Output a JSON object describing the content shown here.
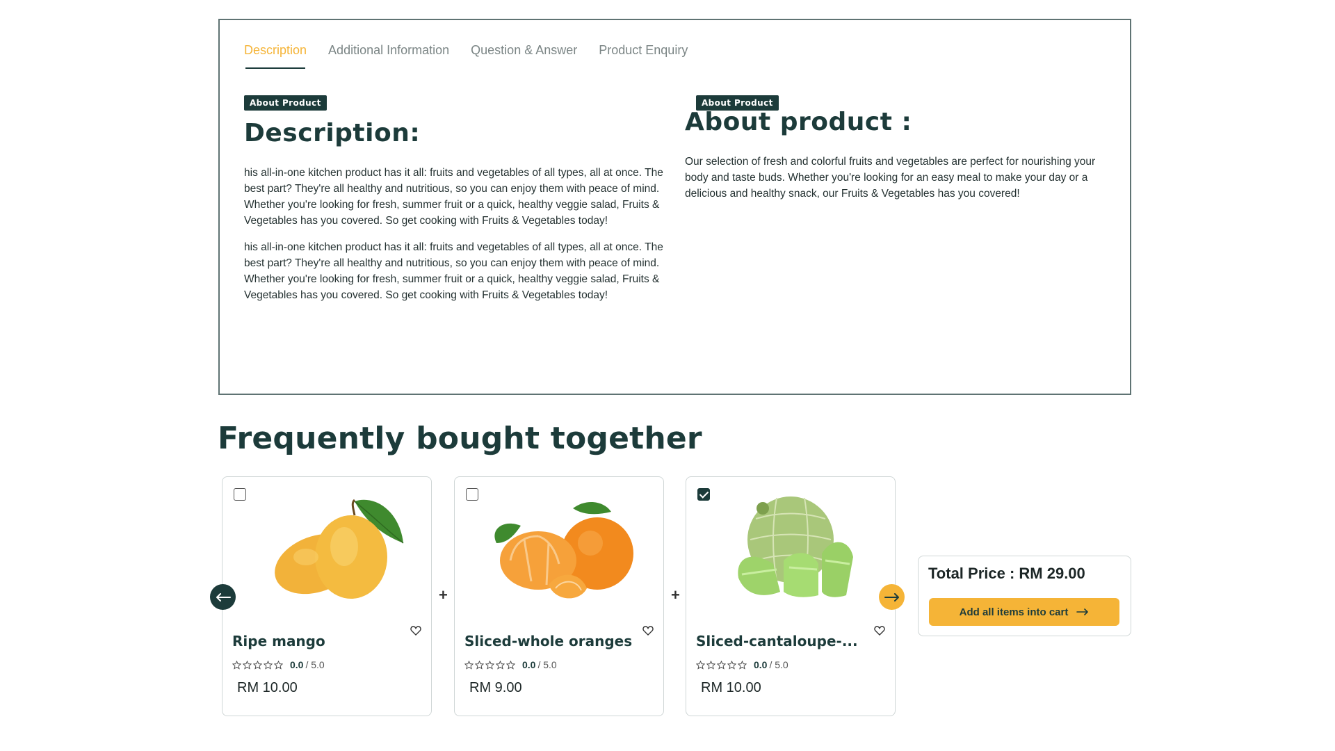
{
  "tabs": [
    {
      "label": "Description",
      "active": true
    },
    {
      "label": "Additional Information",
      "active": false
    },
    {
      "label": "Question & Answer",
      "active": false
    },
    {
      "label": "Product Enquiry",
      "active": false
    }
  ],
  "left": {
    "badge": "About Product",
    "heading": "Description:",
    "para1": "his all-in-one kitchen product has it all: fruits and vegetables of all types, all at once. The best part? They're all healthy and nutritious, so you can enjoy them with peace of mind. Whether you're looking for fresh, summer fruit or a quick, healthy veggie salad, Fruits & Vegetables has you covered. So get cooking with Fruits & Vegetables today!",
    "para2": "his all-in-one kitchen product has it all: fruits and vegetables of all types, all at once. The best part? They're all healthy and nutritious, so you can enjoy them with peace of mind. Whether you're looking for fresh, summer fruit or a quick, healthy veggie salad, Fruits & Vegetables has you covered. So get cooking with Fruits & Vegetables today!"
  },
  "right": {
    "badge": "About Product",
    "heading": "About product :",
    "para": "Our selection of fresh and colorful fruits and vegetables are perfect for nourishing your body and taste buds. Whether you're looking for an easy meal to make your day or a delicious and healthy snack, our Fruits & Vegetables has you covered!"
  },
  "fbt": {
    "title": "Frequently bought together",
    "products": [
      {
        "name": "Ripe mango",
        "score": "0.0",
        "max": "/ 5.0",
        "price": "RM 10.00",
        "checked": false,
        "icon": "mango-image"
      },
      {
        "name": "Sliced-whole oranges",
        "score": "0.0",
        "max": "/ 5.0",
        "price": "RM 9.00",
        "checked": false,
        "icon": "orange-image"
      },
      {
        "name": "Sliced-cantaloupe-...",
        "score": "0.0",
        "max": "/ 5.0",
        "price": "RM 10.00",
        "checked": true,
        "icon": "cantaloupe-image"
      }
    ],
    "plus_sign": "+",
    "total_label": "Total Price : RM 29.00",
    "cart_button": "Add all items into cart"
  },
  "colors": {
    "accent": "#f5b437",
    "dark": "#1c3b3a"
  }
}
